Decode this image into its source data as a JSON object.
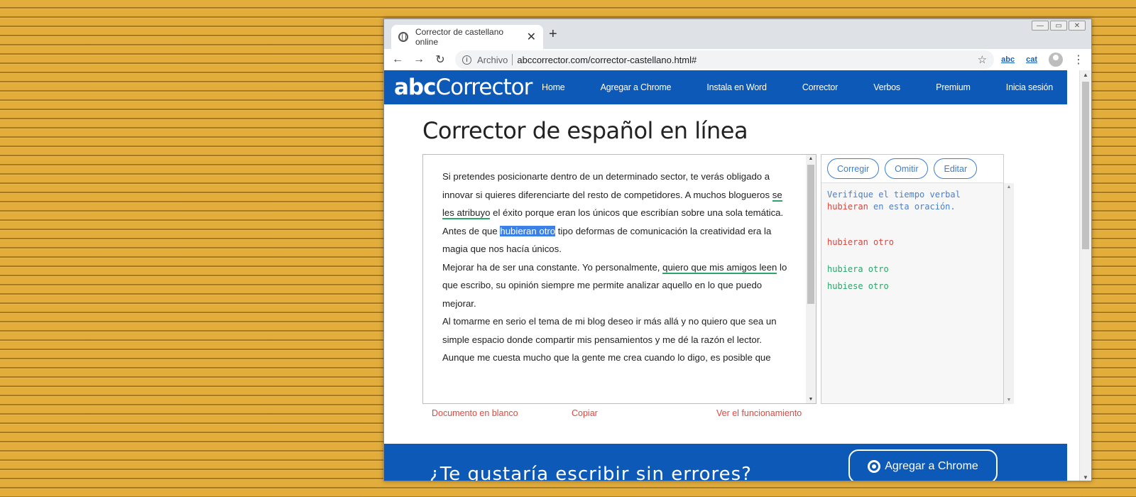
{
  "browser": {
    "tab_title": "Corrector de castellano online",
    "tab_close": "✕",
    "new_tab": "+",
    "win_min": "—",
    "win_max": "▭",
    "win_close": "✕",
    "back": "←",
    "forward": "→",
    "reload": "↻",
    "info": "i",
    "security_label": "Archivo",
    "url": "abccorrector.com/corrector-castellano.html#",
    "star": "☆",
    "ext1": "abc",
    "ext2": "cat",
    "menu": "⋮"
  },
  "site": {
    "logo_bold": "abc",
    "logo_rest": "Corrector",
    "nav": [
      "Home",
      "Agregar a Chrome",
      "Instala en Word",
      "Corrector",
      "Verbos",
      "Premium",
      "Inicia sesión"
    ]
  },
  "page": {
    "title": "Corrector de español en línea",
    "p1_a": "Si pretendes posicionarte dentro de un determinado sector, te verás obligado a innovar si quieres diferenciarte del resto de competidores. A muchos blogueros ",
    "p1_err": "se les atribuyo",
    "p1_b": " el éxito porque eran los únicos que escribían sobre una sola temática.",
    "p2_a": "Antes de que ",
    "p2_err": "hubieran otro",
    "p2_b": " tipo deformas de comunicación la creatividad era la magia que nos hacía únicos.",
    "p3_a": "Mejorar ha de ser una constante. Yo personalmente, ",
    "p3_err": "quiero que mis amigos leen",
    "p3_b": " lo que escribo, su opinión siempre me permite analizar aquello en lo que puedo mejorar.",
    "p4": "Al tomarme en serio el tema de mi blog deseo ir más allá y no quiero que sea un simple espacio donde compartir mis pensamientos y me dé la razón el lector.",
    "p5": "Aunque me cuesta mucho que la gente me crea cuando lo digo, es posible que",
    "scroll_up": "▲",
    "scroll_down": "▼"
  },
  "side": {
    "btn_fix": "Corregir",
    "btn_skip": "Omitir",
    "btn_edit": "Editar",
    "msg_a": "Verifique el tiempo verbal",
    "msg_err": "hubieran",
    "msg_b": " en esta oración.",
    "wrong": "hubieran otro",
    "sugg1": "hubiera otro",
    "sugg2": "hubiese otro"
  },
  "links": {
    "blank": "Documento en blanco",
    "copy": "Copiar",
    "how": "Ver el funcionamiento"
  },
  "footer": {
    "teaser": "¿Te gustaría escribir sin errores?",
    "chrome_btn": "Agregar a Chrome"
  },
  "colors": {
    "brand_blue": "#0d59b7",
    "error_red": "#d9463e",
    "ok_green": "#2aa56b",
    "highlight": "#3a80e6",
    "desktop": "#e3ad3c"
  }
}
